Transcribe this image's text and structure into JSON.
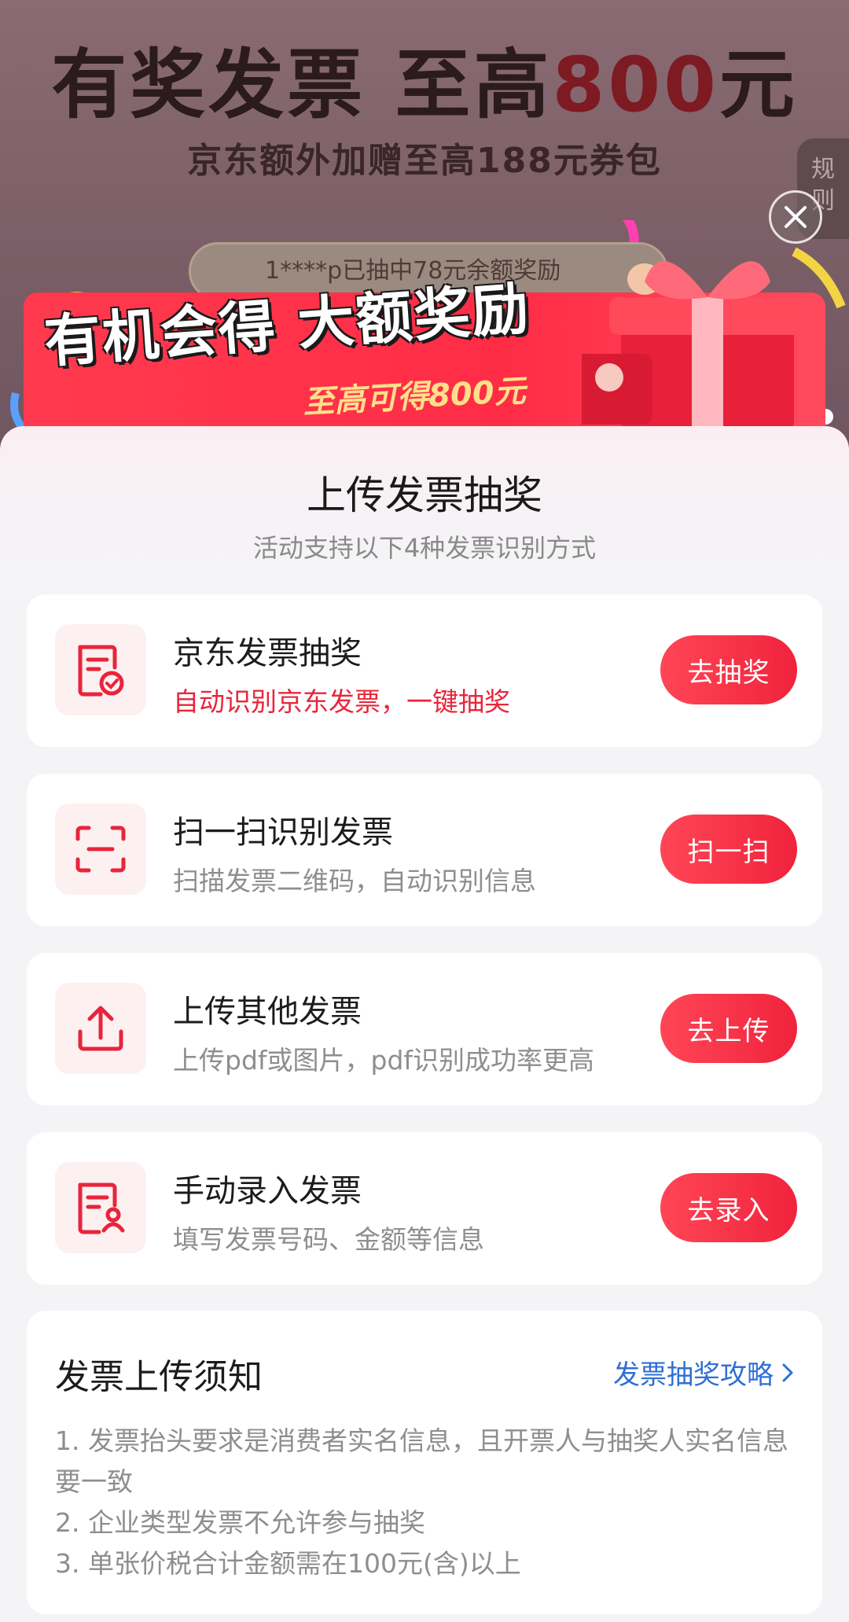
{
  "background": {
    "headline_prefix": "有奖发票 至高",
    "headline_amount": "800",
    "headline_suffix": "元",
    "subline": "京东额外加赠至高188元券包",
    "rules_tab": "规则"
  },
  "banner": {
    "ticker": "1****p已抽中78元余额奖励",
    "title": "有机会得 大额奖励",
    "subtitle": "至高可得800元"
  },
  "sheet": {
    "title": "上传发票抽奖",
    "subtitle": "活动支持以下4种发票识别方式",
    "methods": [
      {
        "title": "京东发票抽奖",
        "desc": "自动识别京东发票，一键抽奖",
        "button": "去抽奖",
        "icon": "invoice-check-icon"
      },
      {
        "title": "扫一扫识别发票",
        "desc": "扫描发票二维码，自动识别信息",
        "button": "扫一扫",
        "icon": "scan-icon"
      },
      {
        "title": "上传其他发票",
        "desc": "上传pdf或图片，pdf识别成功率更高",
        "button": "去上传",
        "icon": "upload-icon"
      },
      {
        "title": "手动录入发票",
        "desc": "填写发票号码、金额等信息",
        "button": "去录入",
        "icon": "invoice-person-icon"
      }
    ]
  },
  "notice": {
    "title": "发票上传须知",
    "link": "发票抽奖攻略",
    "items": [
      " 1. 发票抬头要求是消费者实名信息，且开票人与抽奖人实名信息要一致",
      "2. 企业类型发票不允许参与抽奖",
      "3. 单张价税合计金额需在100元(含)以上"
    ]
  },
  "colors": {
    "accent": "#f0233c",
    "link": "#2f6fd6",
    "muted_text": "#8e8e8e"
  }
}
